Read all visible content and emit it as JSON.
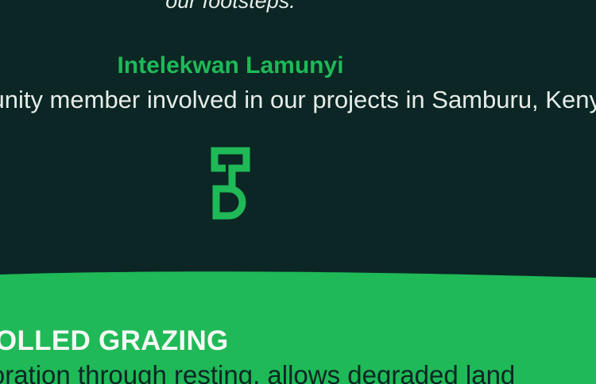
{
  "testimonial": {
    "quote_tail": "our footsteps.",
    "author_name": "Intelekwan Lamunyi",
    "author_role": "Community member involved in our projects in Samburu, Kenya."
  },
  "logo": {
    "icon": "spade-logo-icon",
    "color": "#1fb957"
  },
  "feature_section": {
    "heading": "CONTROLLED GRAZING",
    "body": "Restoration through resting, allows degraded land"
  },
  "colors": {
    "dark_background": "#0b2624",
    "brand_green": "#1fb957",
    "text_light": "#e6ece8"
  }
}
